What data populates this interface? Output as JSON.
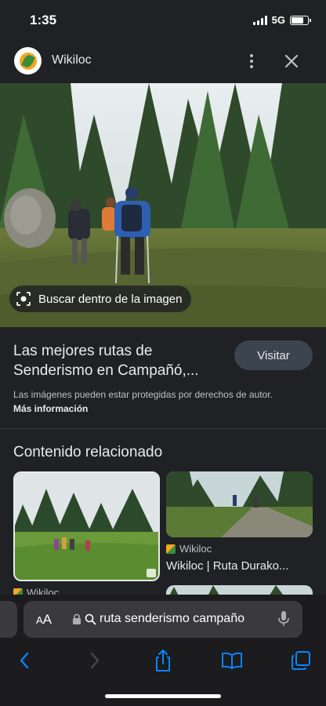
{
  "status_bar": {
    "time": "1:35",
    "network": "5G",
    "battery_level": 0.75
  },
  "header": {
    "site_name": "Wikiloc"
  },
  "hero": {
    "lens_label": "Buscar dentro de la imagen"
  },
  "result": {
    "title": "Las mejores rutas de Senderismo en Campañó,...",
    "visit_label": "Visitar",
    "copyright_text": "Las imágenes pueden estar protegidas por derechos de autor.",
    "more_info_label": "Más información"
  },
  "related": {
    "heading": "Contenido relacionado",
    "cards": [
      {
        "source": "Wikiloc",
        "title": ""
      },
      {
        "source": "Wikiloc",
        "title": "Wikiloc | Ruta Durako..."
      }
    ]
  },
  "browser": {
    "text_size_label_small": "A",
    "text_size_label_large": "A",
    "url_text": "ruta senderismo campaño"
  },
  "colors": {
    "background": "#202124",
    "toolbar": "#1c1c1e",
    "accent": "#0a84ff"
  }
}
